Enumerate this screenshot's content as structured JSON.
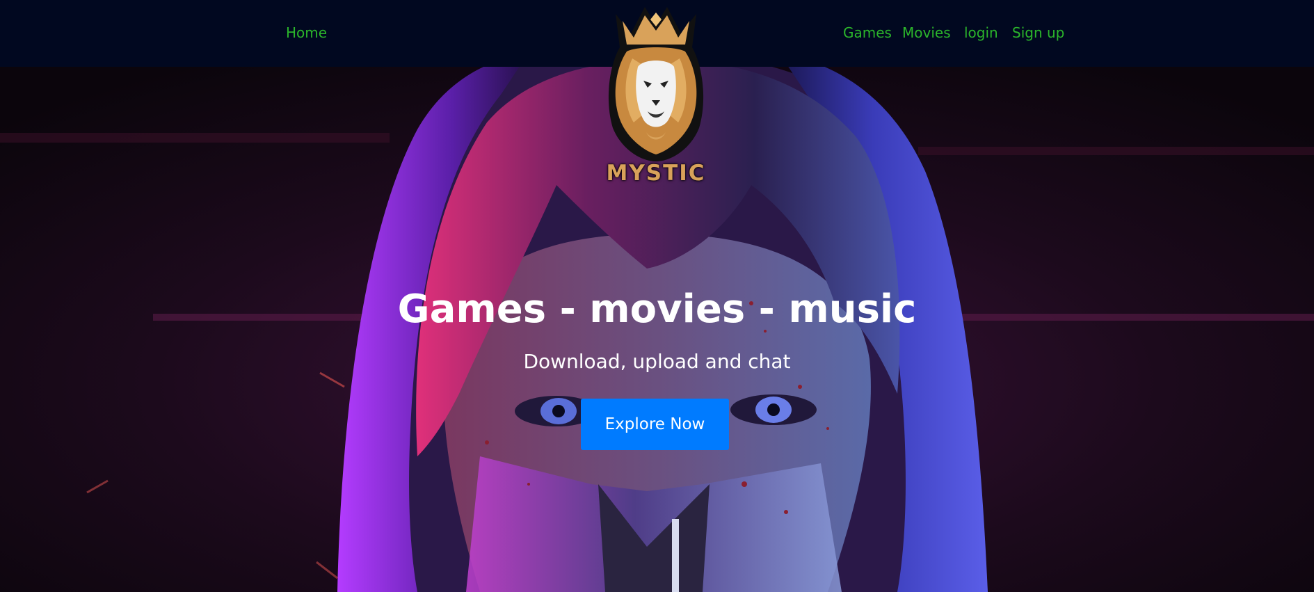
{
  "navbar": {
    "left_links": [
      {
        "label": "Home"
      }
    ],
    "right_links": [
      {
        "label": "Games"
      },
      {
        "label": "Movies"
      },
      {
        "label": "login"
      },
      {
        "label": "Sign up"
      }
    ]
  },
  "logo": {
    "text": "MYSTIC",
    "icon": "lion-crown-icon"
  },
  "hero": {
    "title": "Games - movies - music",
    "subtitle": "Download, upload and chat",
    "cta_label": "Explore Now"
  },
  "colors": {
    "navbar_bg": "#010820",
    "nav_link": "#2bb52b",
    "logo_gold": "#d9a25a",
    "cta_bg": "#007bff",
    "text": "#ffffff"
  }
}
